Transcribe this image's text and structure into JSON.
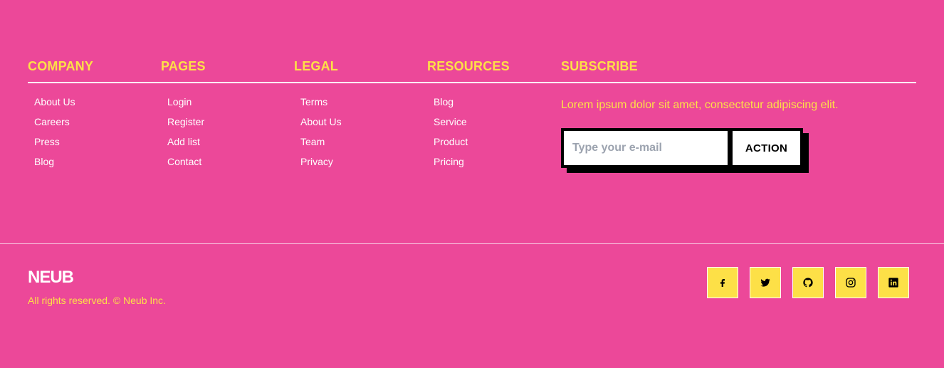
{
  "columns": [
    {
      "title": "COMPANY",
      "links": [
        "About Us",
        "Careers",
        "Press",
        "Blog"
      ]
    },
    {
      "title": "PAGES",
      "links": [
        "Login",
        "Register",
        "Add list",
        "Contact"
      ]
    },
    {
      "title": "LEGAL",
      "links": [
        "Terms",
        "About Us",
        "Team",
        "Privacy"
      ]
    },
    {
      "title": "RESOURCES",
      "links": [
        "Blog",
        "Service",
        "Product",
        "Pricing"
      ]
    }
  ],
  "subscribe": {
    "title": "SUBSCRIBE",
    "description": "Lorem ipsum dolor sit amet, consectetur adipiscing elit.",
    "email_placeholder": "Type your e-mail",
    "email_value": "",
    "action_label": "ACTION"
  },
  "brand": {
    "logo": "NEUB",
    "copyright": "All rights reserved. © Neub Inc."
  },
  "socials": [
    {
      "icon": "facebook-icon"
    },
    {
      "icon": "twitter-icon"
    },
    {
      "icon": "github-icon"
    },
    {
      "icon": "instagram-icon"
    },
    {
      "icon": "linkedin-icon"
    }
  ],
  "colors": {
    "background": "#EC4899",
    "accent": "#FDE047",
    "text": "#FFFFFF",
    "button_text": "#000000"
  }
}
